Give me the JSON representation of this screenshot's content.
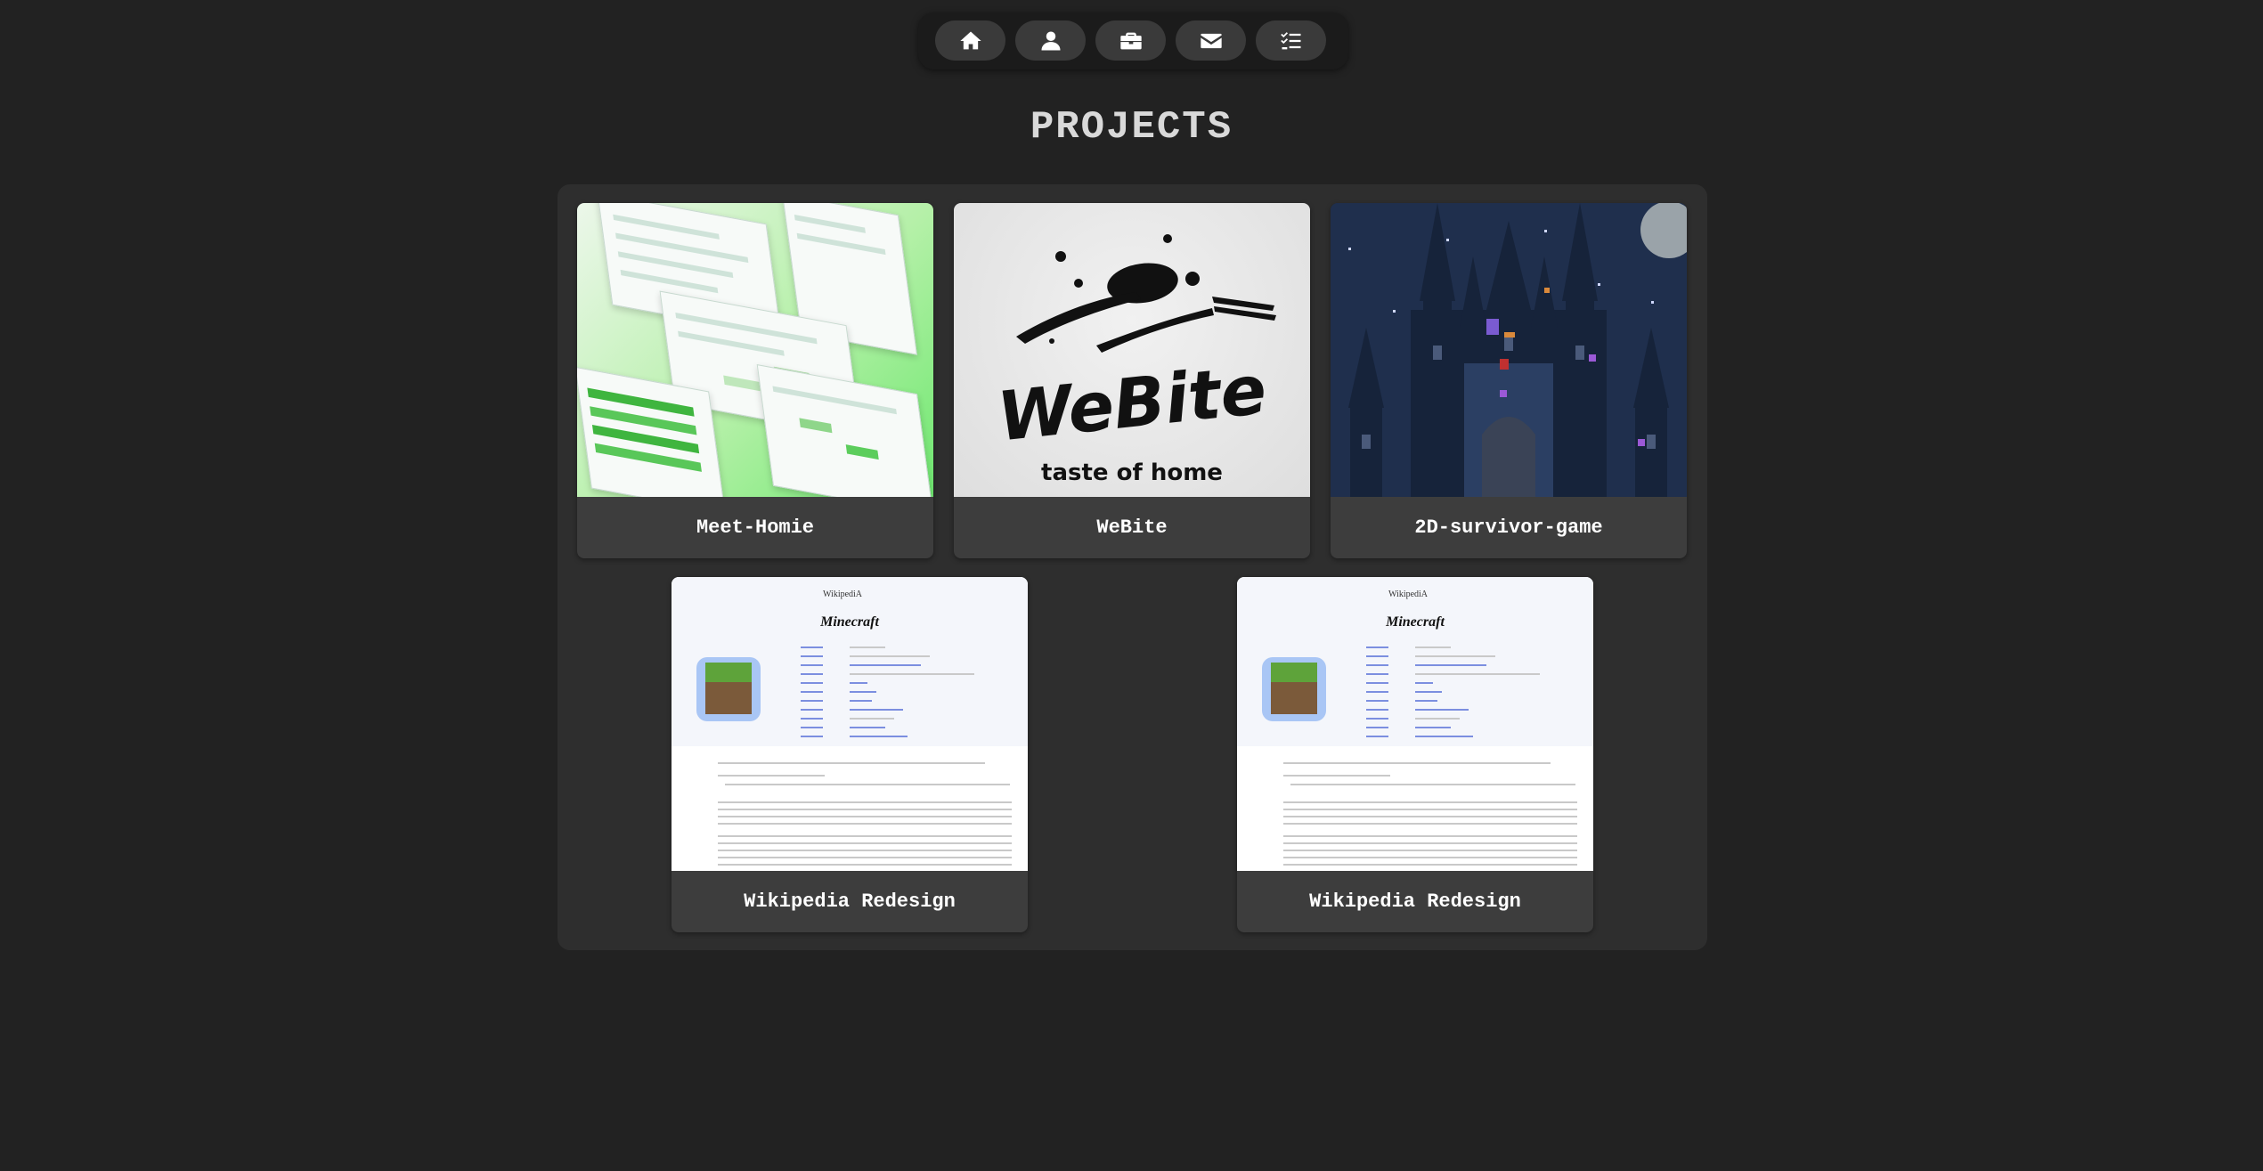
{
  "nav": {
    "items": [
      {
        "icon": "home-icon"
      },
      {
        "icon": "user-icon"
      },
      {
        "icon": "briefcase-icon"
      },
      {
        "icon": "envelope-icon"
      },
      {
        "icon": "checklist-icon"
      }
    ]
  },
  "page": {
    "title": "PROJECTS"
  },
  "projects": [
    {
      "name": "Meet-Homie"
    },
    {
      "name": "WeBite",
      "thumb_word": "WeBite",
      "thumb_tagline": "taste of home"
    },
    {
      "name": "2D-survivor-game"
    },
    {
      "name": "Wikipedia Redesign",
      "thumb_site": "WikipediA",
      "thumb_heading": "Minecraft"
    },
    {
      "name": "Wikipedia Redesign",
      "thumb_site": "WikipediA",
      "thumb_heading": "Minecraft"
    }
  ],
  "colors": {
    "background": "#222222",
    "panel": "#2e2e2e",
    "card": "#3d3d3d",
    "text": "#ffffff"
  }
}
